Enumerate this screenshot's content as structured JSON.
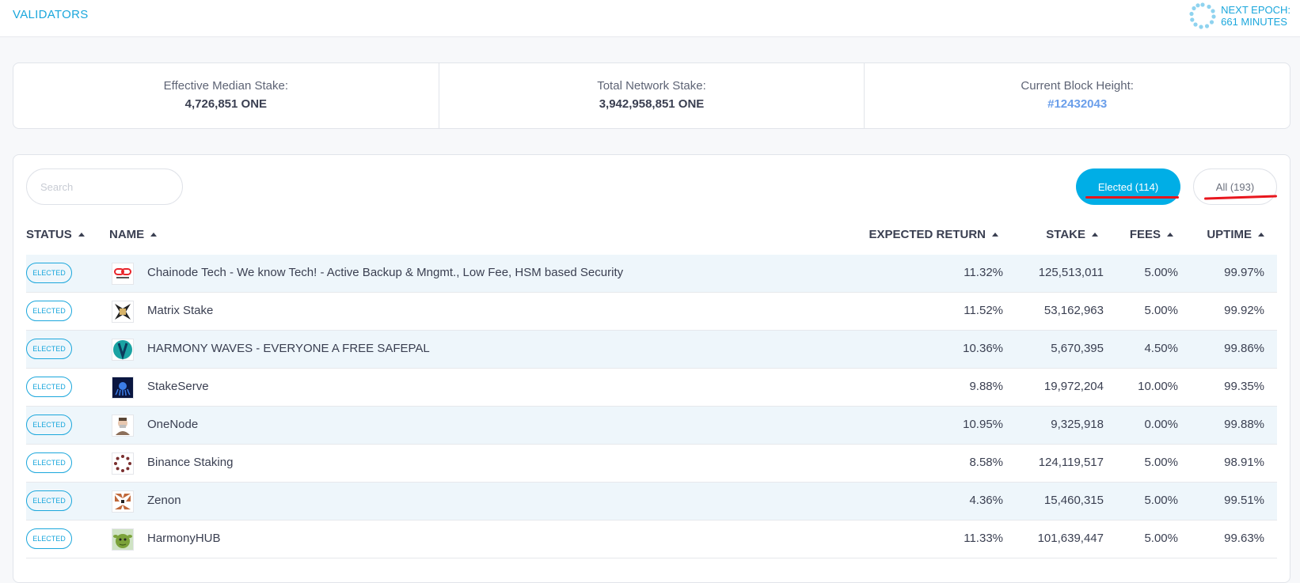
{
  "header": {
    "title": "VALIDATORS",
    "epoch_label": "NEXT EPOCH:",
    "epoch_value": "661 MINUTES"
  },
  "stats": [
    {
      "label": "Effective Median Stake:",
      "value": "4,726,851 ONE"
    },
    {
      "label": "Total Network Stake:",
      "value": "3,942,958,851 ONE"
    },
    {
      "label": "Current Block Height:",
      "value": "#12432043"
    }
  ],
  "filters": {
    "search_placeholder": "Search",
    "elected_label": "Elected (114)",
    "all_label": "All (193)"
  },
  "table": {
    "columns": {
      "status": "STATUS",
      "name": "NAME",
      "expected_return": "EXPECTED RETURN",
      "stake": "STAKE",
      "fees": "FEES",
      "uptime": "UPTIME"
    },
    "rows": [
      {
        "status": "ELECTED",
        "name": "Chainode Tech - We know Tech! - Active Backup & Mngmt., Low Fee, HSM based Security",
        "ret": "11.32%",
        "stake": "125,513,011",
        "fees": "5.00%",
        "uptime": "99.97%",
        "avatar_color": "#e8252b"
      },
      {
        "status": "ELECTED",
        "name": "Matrix Stake",
        "ret": "11.52%",
        "stake": "53,162,963",
        "fees": "5.00%",
        "uptime": "99.92%",
        "avatar_color": "#b08a3a"
      },
      {
        "status": "ELECTED",
        "name": "HARMONY WAVES - EVERYONE A FREE SAFEPAL",
        "ret": "10.36%",
        "stake": "5,670,395",
        "fees": "4.50%",
        "uptime": "99.86%",
        "avatar_color": "#1aa3a3"
      },
      {
        "status": "ELECTED",
        "name": "StakeServe",
        "ret": "9.88%",
        "stake": "19,972,204",
        "fees": "10.00%",
        "uptime": "99.35%",
        "avatar_color": "#0a1640"
      },
      {
        "status": "ELECTED",
        "name": "OneNode",
        "ret": "10.95%",
        "stake": "9,325,918",
        "fees": "0.00%",
        "uptime": "99.88%",
        "avatar_color": "#8c6f5a"
      },
      {
        "status": "ELECTED",
        "name": "Binance Staking",
        "ret": "8.58%",
        "stake": "124,119,517",
        "fees": "5.00%",
        "uptime": "98.91%",
        "avatar_color": "#7a2f2f"
      },
      {
        "status": "ELECTED",
        "name": "Zenon",
        "ret": "4.36%",
        "stake": "15,460,315",
        "fees": "5.00%",
        "uptime": "99.51%",
        "avatar_color": "#c0683a"
      },
      {
        "status": "ELECTED",
        "name": "HarmonyHUB",
        "ret": "11.33%",
        "stake": "101,639,447",
        "fees": "5.00%",
        "uptime": "99.63%",
        "avatar_color": "#6b8e23"
      }
    ]
  },
  "colors": {
    "accent": "#00aee6",
    "link": "#6a9eea",
    "annotation": "#e8161d"
  }
}
